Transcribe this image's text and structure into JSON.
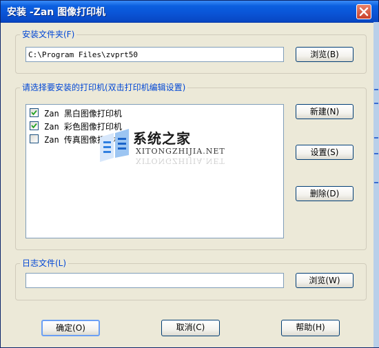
{
  "window": {
    "title": "安装 -Zan 图像打印机"
  },
  "install_folder": {
    "legend": "安装文件夹(F)",
    "path": "C:\\Program Files\\zvprt50",
    "browse_label": "浏览(B)"
  },
  "printers": {
    "legend": "请选择要安装的打印机(双击打印机编辑设置)",
    "items": [
      {
        "label": "Zan 黑白图像打印机",
        "checked": true
      },
      {
        "label": "Zan 彩色图像打印机",
        "checked": true
      },
      {
        "label": "Zan 传真图像打印机",
        "checked": false
      }
    ],
    "new_label": "新建(N)",
    "settings_label": "设置(S)",
    "delete_label": "删除(D)"
  },
  "log_file": {
    "legend": "日志文件(L)",
    "path": "",
    "browse_label": "浏览(W)"
  },
  "buttons": {
    "ok_label": "确定(O)",
    "cancel_label": "取消(C)",
    "help_label": "帮助(H)"
  },
  "watermark": {
    "title": "系统之家",
    "subtitle": "XITONGZHIJIA.NET"
  },
  "colors": {
    "titlebar": "#0a54d6",
    "dialog_bg": "#ece9d8",
    "legend_text": "#0046d5"
  },
  "icons": {
    "close": "close-icon",
    "checkbox": "checkmark-icon",
    "watermark_logo": "window-logo-icon"
  }
}
